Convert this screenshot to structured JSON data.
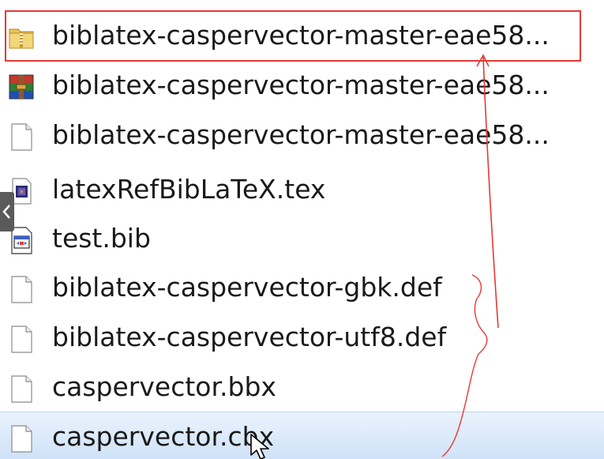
{
  "files": [
    {
      "name": "biblatex-caspervector-master-eae58...",
      "icon": "folder-zip-icon"
    },
    {
      "name": "biblatex-caspervector-master-eae58...",
      "icon": "winrar-archive-icon"
    },
    {
      "name": "biblatex-caspervector-master-eae58...",
      "icon": "blank-file-icon"
    },
    {
      "name": "latexRefBibLaTeX.tex",
      "icon": "tex-file-icon"
    },
    {
      "name": "test.bib",
      "icon": "bib-file-icon"
    },
    {
      "name": "biblatex-caspervector-gbk.def",
      "icon": "blank-file-icon"
    },
    {
      "name": "biblatex-caspervector-utf8.def",
      "icon": "blank-file-icon"
    },
    {
      "name": "caspervector.bbx",
      "icon": "blank-file-icon"
    },
    {
      "name": "caspervector.cbx",
      "icon": "blank-file-icon"
    }
  ],
  "selected_index": 8,
  "colors": {
    "annotation": "#e53935",
    "selection": "#cfe2f8",
    "text": "#1a1a1a"
  }
}
